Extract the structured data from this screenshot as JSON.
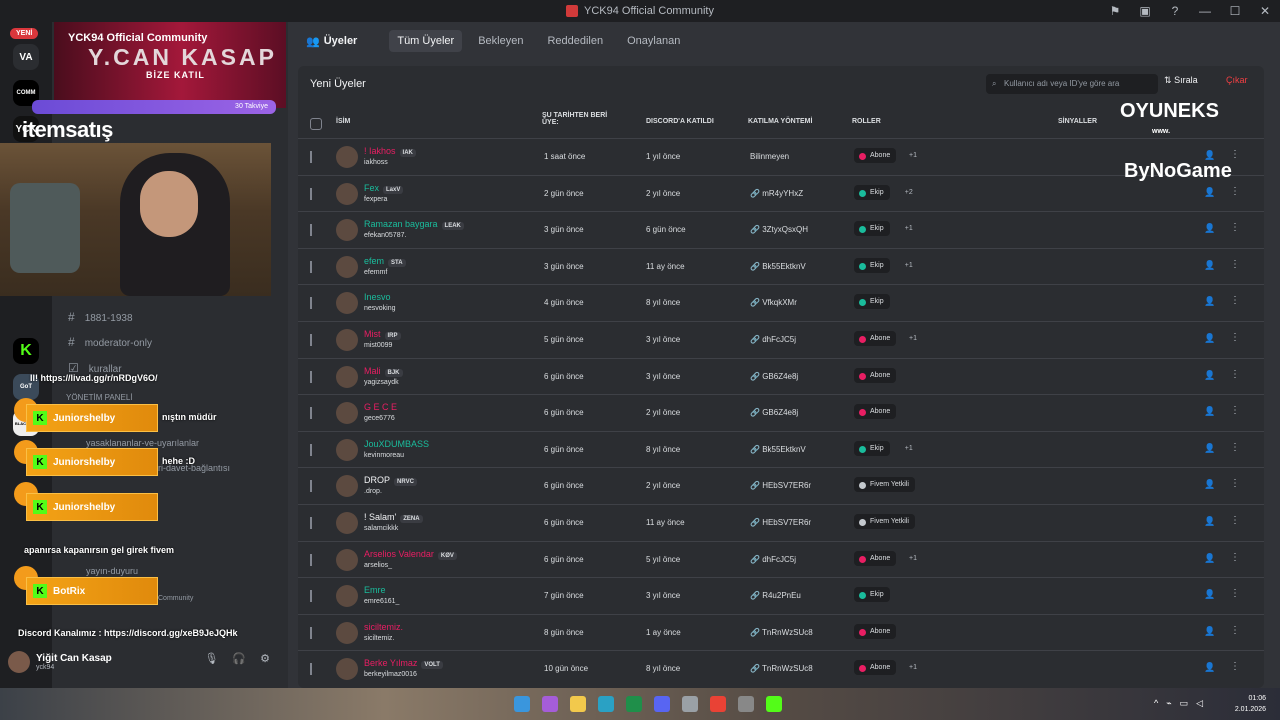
{
  "window": {
    "title": "YCK94 Official Community",
    "controls": [
      "⚑",
      "▣",
      "?",
      "—",
      "☐",
      "✕"
    ]
  },
  "servers": {
    "new_badge": "YENİ",
    "items": [
      "VA",
      "COMM",
      "YCK",
      "K",
      "GoT",
      "BLACKSEA"
    ],
    "unread": "11"
  },
  "sidebar": {
    "server_name": "YCK94 Official Community",
    "banner_title": "Y.CAN KASAP",
    "banner_sub": "BİZE KATIL",
    "boost_text": "30 Takviye",
    "itemsatis": "itemsatış",
    "channels": [
      "1881-1938",
      "moderator-only",
      "kurallar",
      "yasaklananlar-ve-uyarılanlar",
      "ri-davet-bağlantısı",
      "yayın-duyuru"
    ],
    "category": "YÖNETİM PANELİ",
    "voice_label": "Community",
    "discord_link": "Discord Kanalımız : https://discord.gg/xeB9JeJQHk",
    "user": {
      "name": "Yiğit Can Kasap",
      "tag": "yck94"
    }
  },
  "chat": {
    "link_msg": "Il! https://livad.gg/r/nRDgV6O/",
    "msg1": "nıştın müdür",
    "msg2": "hehe :D",
    "msg3": "apanırsa kapanırsın gel girek fivem",
    "sender1": "Juniorshelby",
    "sender2": "Juniorshelby",
    "sender3": "Juniorshelby",
    "sender4": "BotRix"
  },
  "nav": {
    "members_label": "Üyeler",
    "tabs": [
      "Tüm Üyeler",
      "Bekleyen",
      "Reddedilen",
      "Onaylanan"
    ],
    "active_tab": "Tüm Üyeler"
  },
  "panel": {
    "title": "Yeni Üyeler",
    "search_placeholder": "Kullanıcı adı veya ID'ye göre ara",
    "sort_label": "Sırala",
    "kick_label": "Çıkar",
    "headers": {
      "name": "İSİM",
      "since": "ŞU TARİHTEN BERİ ÜYE:",
      "joined": "DISCORD'A KATILDI",
      "method": "KATILMA YÖNTEMİ",
      "roles": "ROLLER",
      "signals": "SİNYALLER"
    }
  },
  "members": [
    {
      "name": "! Iakhos",
      "tag": "IAK",
      "user": "iakhoss",
      "since": "1 saat önce",
      "joined": "1 yıl önce",
      "method": "Bilinmeyen",
      "role": "Abone",
      "role_color": "#e91e63",
      "extra": "+1",
      "name_color": "#e91e63"
    },
    {
      "name": "Fex",
      "tag": "LaxV",
      "user": "fexpera",
      "since": "2 gün önce",
      "joined": "2 yıl önce",
      "method": "mR4yYHxZ",
      "role": "Ekip",
      "role_color": "#1abc9c",
      "extra": "+2",
      "name_color": "#1abc9c"
    },
    {
      "name": "Ramazan baygara",
      "tag": "LEAK",
      "user": "efekan05787.",
      "since": "3 gün önce",
      "joined": "6 gün önce",
      "method": "3ZtyxQsxQH",
      "role": "Ekip",
      "role_color": "#1abc9c",
      "extra": "+1",
      "name_color": "#1abc9c"
    },
    {
      "name": "efem",
      "tag": "STA",
      "user": "efemmf",
      "since": "3 gün önce",
      "joined": "11 ay önce",
      "method": "Bk55EktknV",
      "role": "Ekip",
      "role_color": "#1abc9c",
      "extra": "+1",
      "name_color": "#1abc9c"
    },
    {
      "name": "Inesvo",
      "tag": "",
      "user": "nesvoking",
      "since": "4 gün önce",
      "joined": "8 yıl önce",
      "method": "VfkqkXMr",
      "role": "Ekip",
      "role_color": "#1abc9c",
      "extra": "",
      "name_color": "#1abc9c"
    },
    {
      "name": "Mist",
      "tag": "IRP",
      "user": "mist0099",
      "since": "5 gün önce",
      "joined": "3 yıl önce",
      "method": "dhFcJC5j",
      "role": "Abone",
      "role_color": "#e91e63",
      "extra": "+1",
      "name_color": "#e91e63"
    },
    {
      "name": "Mali",
      "tag": "BJK",
      "user": "yagizsaydk",
      "since": "6 gün önce",
      "joined": "3 yıl önce",
      "method": "GB6Z4e8j",
      "role": "Abone",
      "role_color": "#e91e63",
      "extra": "",
      "name_color": "#e91e63"
    },
    {
      "name": "G E C E",
      "tag": "",
      "user": "gece6776",
      "since": "6 gün önce",
      "joined": "2 yıl önce",
      "method": "GB6Z4e8j",
      "role": "Abone",
      "role_color": "#e91e63",
      "extra": "",
      "name_color": "#e91e63"
    },
    {
      "name": "JouXDUMBASS",
      "tag": "",
      "user": "kevinmoreau",
      "since": "6 gün önce",
      "joined": "8 yıl önce",
      "method": "Bk55EktknV",
      "role": "Ekip",
      "role_color": "#1abc9c",
      "extra": "+1",
      "name_color": "#1abc9c"
    },
    {
      "name": "DROP",
      "tag": "NRVC",
      "user": ".drop.",
      "since": "6 gün önce",
      "joined": "2 yıl önce",
      "method": "HEbSV7ER6r",
      "role": "Fivem Yetkili",
      "role_color": "#c4c9ce",
      "extra": "",
      "name_color": "#f2f3f5"
    },
    {
      "name": "! Salam'",
      "tag": "ZENA",
      "user": "salamcikkk",
      "since": "6 gün önce",
      "joined": "11 ay önce",
      "method": "HEbSV7ER6r",
      "role": "Fivem Yetkili",
      "role_color": "#c4c9ce",
      "extra": "",
      "name_color": "#f2f3f5"
    },
    {
      "name": "Arselios Valendar",
      "tag": "KØV",
      "user": "arselios_",
      "since": "6 gün önce",
      "joined": "5 yıl önce",
      "method": "dhFcJC5j",
      "role": "Abone",
      "role_color": "#e91e63",
      "extra": "+1",
      "name_color": "#e91e63"
    },
    {
      "name": "Emre",
      "tag": "",
      "user": "emre6161_",
      "since": "7 gün önce",
      "joined": "3 yıl önce",
      "method": "R4u2PnEu",
      "role": "Ekip",
      "role_color": "#1abc9c",
      "extra": "",
      "name_color": "#1abc9c"
    },
    {
      "name": "siciltemiz.",
      "tag": "",
      "user": "siciltemiz.",
      "since": "8 gün önce",
      "joined": "1 ay önce",
      "method": "TnRnWzSUc8",
      "role": "Abone",
      "role_color": "#e91e63",
      "extra": "",
      "name_color": "#e91e63"
    },
    {
      "name": "Berke Yılmaz",
      "tag": "VOLT",
      "user": "berkeyilmaz0016",
      "since": "10 gün önce",
      "joined": "8 yıl önce",
      "method": "TnRnWzSUc8",
      "role": "Abone",
      "role_color": "#e91e63",
      "extra": "+1",
      "name_color": "#e91e63"
    }
  ],
  "overlay": {
    "sponsor1": "OYUNEKS",
    "sponsor1_sub": "www.",
    "sponsor2": "ByNoGame"
  },
  "taskbar": {
    "time": "01:06",
    "date": "2.01.2026"
  }
}
